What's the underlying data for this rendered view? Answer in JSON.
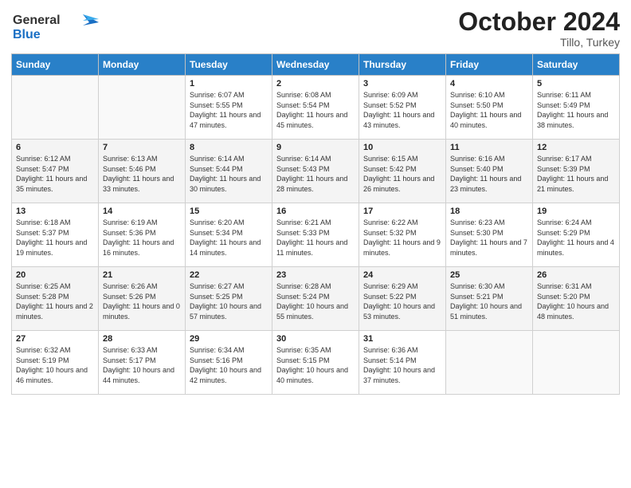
{
  "header": {
    "logo_line1": "General",
    "logo_line2": "Blue",
    "month": "October 2024",
    "location": "Tillo, Turkey"
  },
  "days_of_week": [
    "Sunday",
    "Monday",
    "Tuesday",
    "Wednesday",
    "Thursday",
    "Friday",
    "Saturday"
  ],
  "weeks": [
    [
      {
        "day": "",
        "info": ""
      },
      {
        "day": "",
        "info": ""
      },
      {
        "day": "1",
        "info": "Sunrise: 6:07 AM\nSunset: 5:55 PM\nDaylight: 11 hours and 47 minutes."
      },
      {
        "day": "2",
        "info": "Sunrise: 6:08 AM\nSunset: 5:54 PM\nDaylight: 11 hours and 45 minutes."
      },
      {
        "day": "3",
        "info": "Sunrise: 6:09 AM\nSunset: 5:52 PM\nDaylight: 11 hours and 43 minutes."
      },
      {
        "day": "4",
        "info": "Sunrise: 6:10 AM\nSunset: 5:50 PM\nDaylight: 11 hours and 40 minutes."
      },
      {
        "day": "5",
        "info": "Sunrise: 6:11 AM\nSunset: 5:49 PM\nDaylight: 11 hours and 38 minutes."
      }
    ],
    [
      {
        "day": "6",
        "info": "Sunrise: 6:12 AM\nSunset: 5:47 PM\nDaylight: 11 hours and 35 minutes."
      },
      {
        "day": "7",
        "info": "Sunrise: 6:13 AM\nSunset: 5:46 PM\nDaylight: 11 hours and 33 minutes."
      },
      {
        "day": "8",
        "info": "Sunrise: 6:14 AM\nSunset: 5:44 PM\nDaylight: 11 hours and 30 minutes."
      },
      {
        "day": "9",
        "info": "Sunrise: 6:14 AM\nSunset: 5:43 PM\nDaylight: 11 hours and 28 minutes."
      },
      {
        "day": "10",
        "info": "Sunrise: 6:15 AM\nSunset: 5:42 PM\nDaylight: 11 hours and 26 minutes."
      },
      {
        "day": "11",
        "info": "Sunrise: 6:16 AM\nSunset: 5:40 PM\nDaylight: 11 hours and 23 minutes."
      },
      {
        "day": "12",
        "info": "Sunrise: 6:17 AM\nSunset: 5:39 PM\nDaylight: 11 hours and 21 minutes."
      }
    ],
    [
      {
        "day": "13",
        "info": "Sunrise: 6:18 AM\nSunset: 5:37 PM\nDaylight: 11 hours and 19 minutes."
      },
      {
        "day": "14",
        "info": "Sunrise: 6:19 AM\nSunset: 5:36 PM\nDaylight: 11 hours and 16 minutes."
      },
      {
        "day": "15",
        "info": "Sunrise: 6:20 AM\nSunset: 5:34 PM\nDaylight: 11 hours and 14 minutes."
      },
      {
        "day": "16",
        "info": "Sunrise: 6:21 AM\nSunset: 5:33 PM\nDaylight: 11 hours and 11 minutes."
      },
      {
        "day": "17",
        "info": "Sunrise: 6:22 AM\nSunset: 5:32 PM\nDaylight: 11 hours and 9 minutes."
      },
      {
        "day": "18",
        "info": "Sunrise: 6:23 AM\nSunset: 5:30 PM\nDaylight: 11 hours and 7 minutes."
      },
      {
        "day": "19",
        "info": "Sunrise: 6:24 AM\nSunset: 5:29 PM\nDaylight: 11 hours and 4 minutes."
      }
    ],
    [
      {
        "day": "20",
        "info": "Sunrise: 6:25 AM\nSunset: 5:28 PM\nDaylight: 11 hours and 2 minutes."
      },
      {
        "day": "21",
        "info": "Sunrise: 6:26 AM\nSunset: 5:26 PM\nDaylight: 11 hours and 0 minutes."
      },
      {
        "day": "22",
        "info": "Sunrise: 6:27 AM\nSunset: 5:25 PM\nDaylight: 10 hours and 57 minutes."
      },
      {
        "day": "23",
        "info": "Sunrise: 6:28 AM\nSunset: 5:24 PM\nDaylight: 10 hours and 55 minutes."
      },
      {
        "day": "24",
        "info": "Sunrise: 6:29 AM\nSunset: 5:22 PM\nDaylight: 10 hours and 53 minutes."
      },
      {
        "day": "25",
        "info": "Sunrise: 6:30 AM\nSunset: 5:21 PM\nDaylight: 10 hours and 51 minutes."
      },
      {
        "day": "26",
        "info": "Sunrise: 6:31 AM\nSunset: 5:20 PM\nDaylight: 10 hours and 48 minutes."
      }
    ],
    [
      {
        "day": "27",
        "info": "Sunrise: 6:32 AM\nSunset: 5:19 PM\nDaylight: 10 hours and 46 minutes."
      },
      {
        "day": "28",
        "info": "Sunrise: 6:33 AM\nSunset: 5:17 PM\nDaylight: 10 hours and 44 minutes."
      },
      {
        "day": "29",
        "info": "Sunrise: 6:34 AM\nSunset: 5:16 PM\nDaylight: 10 hours and 42 minutes."
      },
      {
        "day": "30",
        "info": "Sunrise: 6:35 AM\nSunset: 5:15 PM\nDaylight: 10 hours and 40 minutes."
      },
      {
        "day": "31",
        "info": "Sunrise: 6:36 AM\nSunset: 5:14 PM\nDaylight: 10 hours and 37 minutes."
      },
      {
        "day": "",
        "info": ""
      },
      {
        "day": "",
        "info": ""
      }
    ]
  ]
}
